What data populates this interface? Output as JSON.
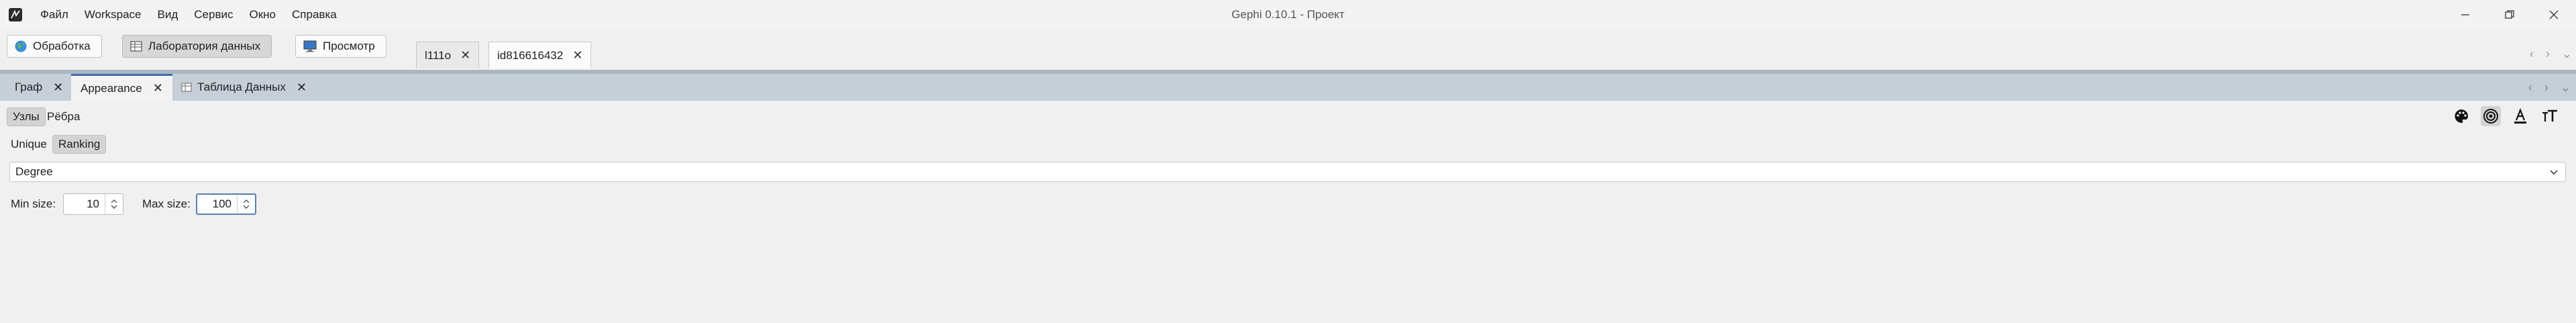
{
  "window": {
    "title": "Gephi 0.10.1 - Проект",
    "logo_icon": "gephi-logo-icon",
    "controls": [
      "minimize-icon",
      "restore-icon",
      "close-icon"
    ]
  },
  "menu": {
    "items": [
      "Файл",
      "Workspace",
      "Вид",
      "Сервис",
      "Окно",
      "Справка"
    ]
  },
  "toolbar": {
    "buttons": [
      {
        "label": "Обработка",
        "icon": "globe-icon",
        "active": false
      },
      {
        "label": "Лаборатория данных",
        "icon": "table-icon",
        "active": true
      },
      {
        "label": "Просмотр",
        "icon": "monitor-icon",
        "active": false
      }
    ],
    "project_tabs": [
      {
        "label": "l111o",
        "active": false
      },
      {
        "label": "id816616432",
        "active": true
      }
    ]
  },
  "panel_tabs": [
    {
      "label": "Граф",
      "active": false
    },
    {
      "label": "Appearance",
      "active": true
    },
    {
      "label": "Таблица Данных",
      "active": false,
      "icon": "table-icon"
    }
  ],
  "appearance": {
    "element_toggle": [
      {
        "label": "Узлы",
        "selected": true
      },
      {
        "label": "Рёбра",
        "selected": false
      }
    ],
    "mode_toggle": [
      {
        "label": "Unique",
        "selected": false
      },
      {
        "label": "Ranking",
        "selected": true
      }
    ],
    "attribute_select": "Degree",
    "min_size_label": "Min size:",
    "min_size": "10",
    "max_size_label": "Max size:",
    "max_size": "100",
    "tools": [
      {
        "icon": "palette-icon",
        "selected": false
      },
      {
        "icon": "node-size-icon",
        "selected": true
      },
      {
        "icon": "label-color-icon",
        "selected": false
      },
      {
        "icon": "label-size-icon",
        "selected": false
      }
    ]
  },
  "colors": {
    "accent": "#3f6ea7",
    "tab_bar": "#c6ced8",
    "separator": "#aab6c3"
  }
}
